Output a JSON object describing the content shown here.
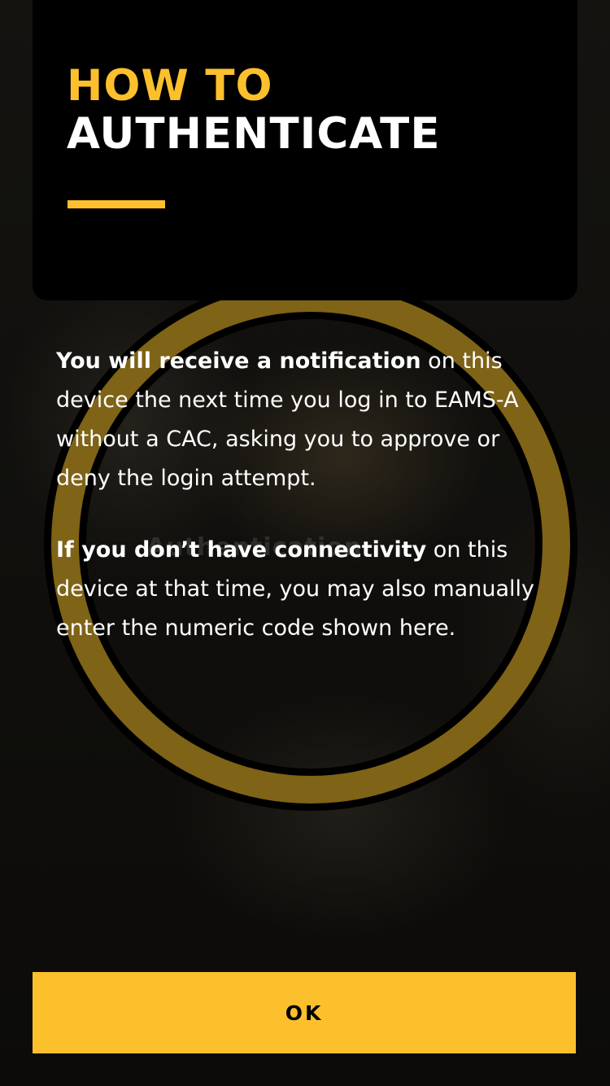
{
  "header": {
    "title_line1": "HOW TO",
    "title_line2": "AUTHENTICATE"
  },
  "content": {
    "paragraph1_bold": "You will receive a notification",
    "paragraph1_rest": " on this device the next time you log in to EAMS-A without a CAC, asking you to approve or deny the login attempt.",
    "paragraph2_bold": "If you don’t have connectivity",
    "paragraph2_rest": " on this device at that time, you may also manually enter the numeric code shown here."
  },
  "background": {
    "faded_text": "Authentication"
  },
  "actions": {
    "ok_label": "OK"
  },
  "colors": {
    "accent": "#fcc02d",
    "card": "#000000",
    "text": "#ffffff"
  }
}
